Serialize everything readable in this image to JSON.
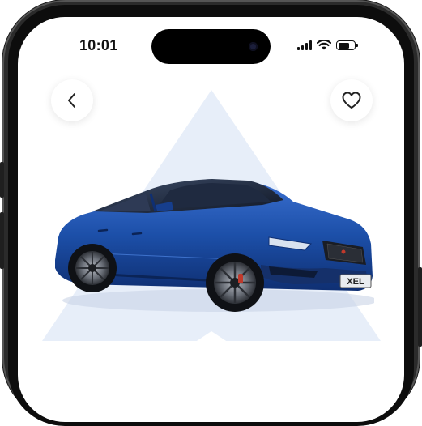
{
  "status_bar": {
    "time": "10:01",
    "signal_bars": 4,
    "battery_level": 0.7
  },
  "header": {
    "back_icon": "chevron-left-icon",
    "favorite_icon": "heart-outline-icon"
  },
  "car": {
    "plate_text": "XEL",
    "body_color": "#1c4fa8"
  },
  "colors": {
    "accent_background": "#e7eef9",
    "frame": "#1a1a1a"
  }
}
